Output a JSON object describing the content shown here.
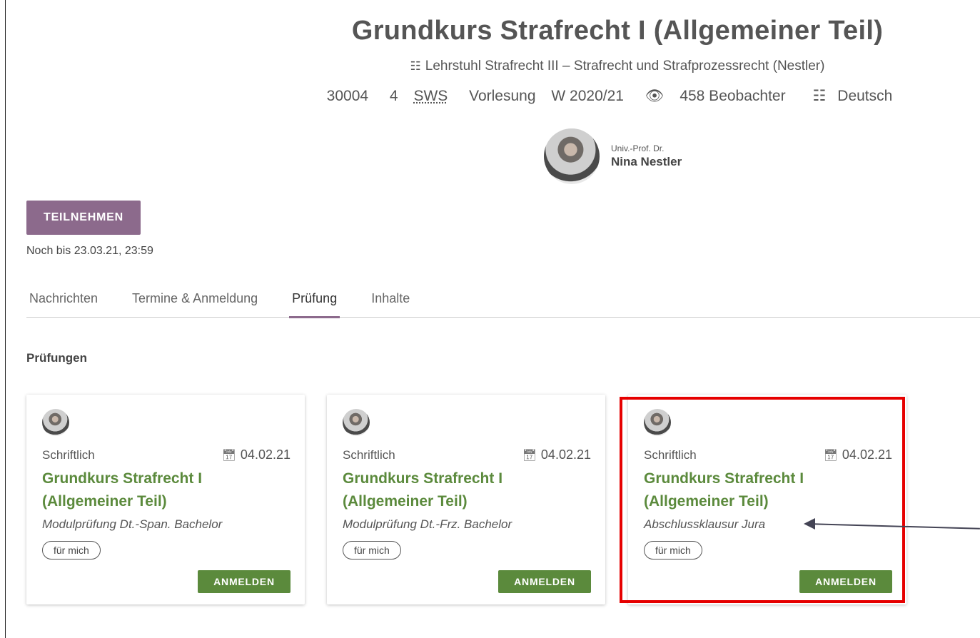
{
  "course": {
    "title": "Grundkurs Strafrecht I (Allgemeiner Teil)",
    "org_icon": "org-chart-icon",
    "org": "Lehrstuhl Strafrecht III – Strafrecht und Strafprozessrecht (Nestler)",
    "number": "30004",
    "sws_value": "4",
    "sws_label": "SWS",
    "type": "Vorlesung",
    "semester": "W 2020/21",
    "watchers": "458 Beobachter",
    "language": "Deutsch"
  },
  "lecturer": {
    "title": "Univ.-Prof. Dr.",
    "name": "Nina Nestler"
  },
  "join": {
    "label": "TEILNEHMEN",
    "deadline": "Noch bis 23.03.21, 23:59"
  },
  "tabs": [
    {
      "label": "Nachrichten",
      "active": false
    },
    {
      "label": "Termine & Anmeldung",
      "active": false
    },
    {
      "label": "Prüfung",
      "active": true
    },
    {
      "label": "Inhalte",
      "active": false
    }
  ],
  "section_title": "Prüfungen",
  "exams": [
    {
      "type": "Schriftlich",
      "date": "04.02.21",
      "title": "Grundkurs Strafrecht I (Allgemeiner Teil)",
      "subtitle": "Modulprüfung Dt.-Span. Bachelor",
      "pill": "für mich",
      "button": "ANMELDEN"
    },
    {
      "type": "Schriftlich",
      "date": "04.02.21",
      "title": "Grundkurs Strafrecht I (Allgemeiner Teil)",
      "subtitle": "Modulprüfung Dt.-Frz. Bachelor",
      "pill": "für mich",
      "button": "ANMELDEN"
    },
    {
      "type": "Schriftlich",
      "date": "04.02.21",
      "title": "Grundkurs Strafrecht I (Allgemeiner Teil)",
      "subtitle": "Abschlussklausur Jura",
      "pill": "für mich",
      "button": "ANMELDEN"
    }
  ],
  "colors": {
    "accent_purple": "#8c6a8c",
    "accent_green": "#5b8a3c",
    "highlight_red": "#e60000"
  }
}
